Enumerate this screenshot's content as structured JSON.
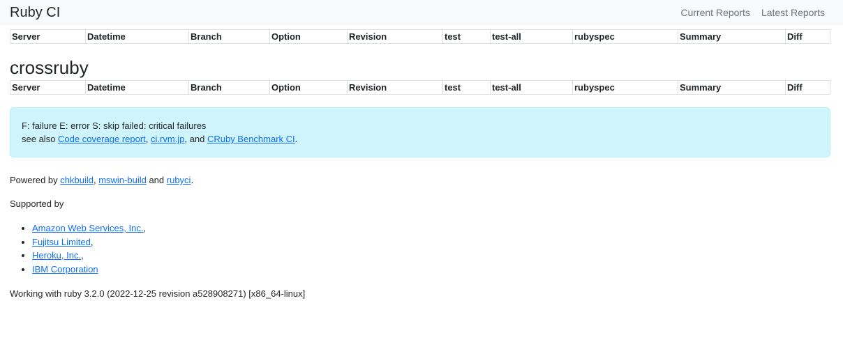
{
  "navbar": {
    "brand": "Ruby CI",
    "links": [
      "Current Reports",
      "Latest Reports"
    ]
  },
  "table_headers": [
    "Server",
    "Datetime",
    "Branch",
    "Option",
    "Revision",
    "test",
    "test-all",
    "rubyspec",
    "Summary",
    "Diff"
  ],
  "section_title": "crossruby",
  "legend": {
    "line1": "F: failure E: error S: skip failed: critical failures",
    "see_also_prefix": "see also ",
    "link1": "Code coverage report",
    "sep1": ", ",
    "link2": "ci.rvm.jp",
    "sep2": ", and ",
    "link3": "CRuby Benchmark CI",
    "end": "."
  },
  "powered": {
    "prefix": "Powered by ",
    "link1": "chkbuild",
    "sep1": ", ",
    "link2": "mswin-build",
    "sep2": " and ",
    "link3": "rubyci",
    "end": "."
  },
  "supported_label": "Supported by",
  "sponsors": [
    {
      "name": "Amazon Web Services, Inc.",
      "suffix": ","
    },
    {
      "name": "Fujitsu Limited",
      "suffix": ","
    },
    {
      "name": "Heroku, Inc.",
      "suffix": ","
    },
    {
      "name": "IBM Corporation",
      "suffix": ""
    }
  ],
  "working_with": "Working with ruby 3.2.0 (2022-12-25 revision a528908271) [x86_64-linux]"
}
